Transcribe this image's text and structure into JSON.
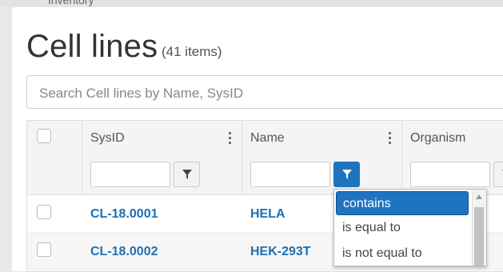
{
  "breadcrumb": {
    "label": "Inventory"
  },
  "page": {
    "title": "Cell lines",
    "count": "(41 items)"
  },
  "search": {
    "placeholder": "Search Cell lines by Name, SysID"
  },
  "columns": [
    {
      "label": "SysID"
    },
    {
      "label": "Name"
    },
    {
      "label": "Organism"
    }
  ],
  "rows": [
    {
      "sysid": "CL-18.0001",
      "name": "HELA"
    },
    {
      "sysid": "CL-18.0002",
      "name": "HEK-293T"
    }
  ],
  "filter_menu": {
    "options": [
      "contains",
      "is equal to",
      "is not equal to"
    ],
    "selected": "contains"
  },
  "icons": [
    "filter-icon",
    "kebab-menu-icon",
    "checkbox-icon",
    "scroll-up-icon"
  ],
  "colors": {
    "accent": "#1f74c0",
    "link": "#1f6fb2"
  }
}
